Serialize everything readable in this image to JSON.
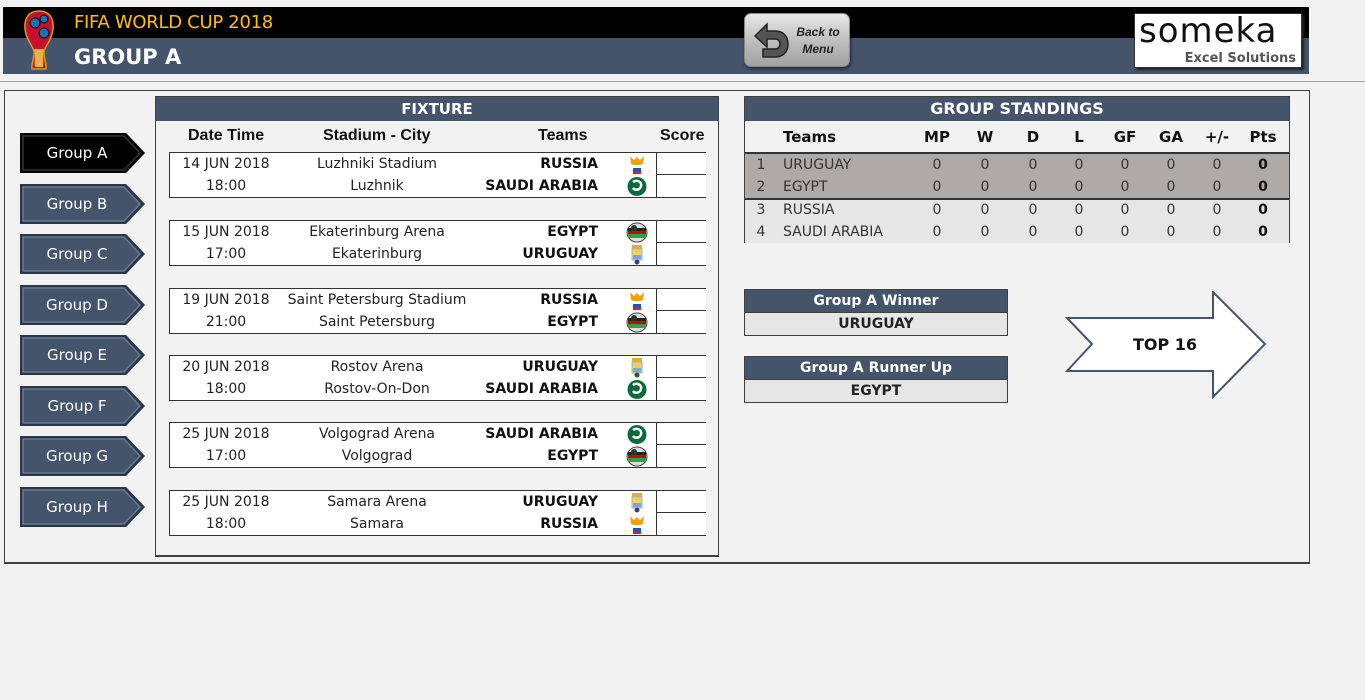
{
  "header": {
    "app_title": "FIFA WORLD CUP 2018",
    "page_title": "GROUP A",
    "back_button": {
      "line1": "Back to",
      "line2": "Menu",
      "icon": "undo-arrow-icon"
    },
    "logo": {
      "brand": "someka",
      "tagline": "Excel Solutions"
    }
  },
  "colors": {
    "header_bar": "#000000",
    "header_blue": "#44546a",
    "title_gold": "#ffc000",
    "active_group": "#000000",
    "group_button": "#44546a",
    "standings_qualified": "#aeaaaa",
    "standings_other": "#e7e6e6"
  },
  "group_nav": {
    "active": "Group A",
    "items": [
      {
        "label": "Group A",
        "active": true
      },
      {
        "label": "Group B",
        "active": false
      },
      {
        "label": "Group C",
        "active": false
      },
      {
        "label": "Group D",
        "active": false
      },
      {
        "label": "Group E",
        "active": false
      },
      {
        "label": "Group F",
        "active": false
      },
      {
        "label": "Group G",
        "active": false
      },
      {
        "label": "Group H",
        "active": false
      }
    ]
  },
  "fixture": {
    "title": "FIXTURE",
    "columns": {
      "datetime": "Date Time",
      "stadium_city": "Stadium - City",
      "teams": "Teams",
      "score": "Score"
    },
    "matches": [
      {
        "date": "14 JUN 2018",
        "time": "18:00",
        "stadium": "Luzhniki Stadium",
        "city": "Luzhnik",
        "team1": "RUSSIA",
        "team2": "SAUDI ARABIA",
        "flag1": "russia-crest-icon",
        "flag2": "saudi-arabia-crest-icon",
        "score1": "",
        "score2": ""
      },
      {
        "date": "15 JUN 2018",
        "time": "17:00",
        "stadium": "Ekaterinburg Arena",
        "city": "Ekaterinburg",
        "team1": "EGYPT",
        "team2": "URUGUAY",
        "flag1": "egypt-crest-icon",
        "flag2": "uruguay-crest-icon",
        "score1": "",
        "score2": ""
      },
      {
        "date": "19 JUN 2018",
        "time": "21:00",
        "stadium": "Saint Petersburg Stadium",
        "city": "Saint Petersburg",
        "team1": "RUSSIA",
        "team2": "EGYPT",
        "flag1": "russia-crest-icon",
        "flag2": "egypt-crest-icon",
        "score1": "",
        "score2": ""
      },
      {
        "date": "20 JUN 2018",
        "time": "18:00",
        "stadium": "Rostov Arena",
        "city": "Rostov-On-Don",
        "team1": "URUGUAY",
        "team2": "SAUDI ARABIA",
        "flag1": "uruguay-crest-icon",
        "flag2": "saudi-arabia-crest-icon",
        "score1": "",
        "score2": ""
      },
      {
        "date": "25 JUN 2018",
        "time": "17:00",
        "stadium": "Volgograd Arena",
        "city": "Volgograd",
        "team1": "SAUDI ARABIA",
        "team2": "EGYPT",
        "flag1": "saudi-arabia-crest-icon",
        "flag2": "egypt-crest-icon",
        "score1": "",
        "score2": ""
      },
      {
        "date": "25 JUN 2018",
        "time": "18:00",
        "stadium": "Samara Arena",
        "city": "Samara",
        "team1": "URUGUAY",
        "team2": "RUSSIA",
        "flag1": "uruguay-crest-icon",
        "flag2": "russia-crest-icon",
        "score1": "",
        "score2": ""
      }
    ]
  },
  "standings": {
    "title": "GROUP STANDINGS",
    "columns": [
      "Teams",
      "MP",
      "W",
      "D",
      "L",
      "GF",
      "GA",
      "+/-",
      "Pts"
    ],
    "rows": [
      {
        "pos": "1",
        "team": "URUGUAY",
        "mp": "0",
        "w": "0",
        "d": "0",
        "l": "0",
        "gf": "0",
        "ga": "0",
        "diff": "0",
        "pts": "0"
      },
      {
        "pos": "2",
        "team": "EGYPT",
        "mp": "0",
        "w": "0",
        "d": "0",
        "l": "0",
        "gf": "0",
        "ga": "0",
        "diff": "0",
        "pts": "0"
      },
      {
        "pos": "3",
        "team": "RUSSIA",
        "mp": "0",
        "w": "0",
        "d": "0",
        "l": "0",
        "gf": "0",
        "ga": "0",
        "diff": "0",
        "pts": "0"
      },
      {
        "pos": "4",
        "team": "SAUDI ARABIA",
        "mp": "0",
        "w": "0",
        "d": "0",
        "l": "0",
        "gf": "0",
        "ga": "0",
        "diff": "0",
        "pts": "0"
      }
    ]
  },
  "results": {
    "winner_label": "Group A Winner",
    "winner": "URUGUAY",
    "runner_up_label": "Group A Runner Up",
    "runner_up": "EGYPT"
  },
  "top16_button": "TOP 16"
}
